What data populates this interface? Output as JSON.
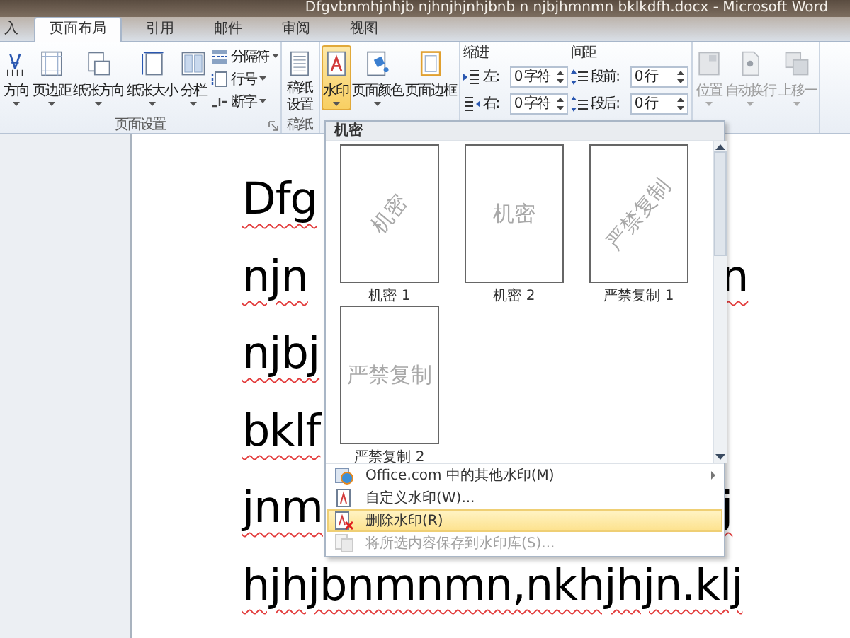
{
  "window": {
    "title": "Dfgvbnmhjnhjb njhnjhjnhjbnb  n njbjhmnmn bklkdfh.docx - Microsoft Word"
  },
  "tabs": [
    {
      "label": "入",
      "selected": false
    },
    {
      "label": "页面布局",
      "selected": true
    },
    {
      "label": "引用",
      "selected": false
    },
    {
      "label": "邮件",
      "selected": false
    },
    {
      "label": "审阅",
      "selected": false
    },
    {
      "label": "视图",
      "selected": false
    }
  ],
  "ribbon": {
    "groups": [
      {
        "kind": "buttons",
        "label": "页面设置",
        "launcher": true,
        "large_buttons": [
          {
            "label": "方向",
            "dropdown": true
          },
          {
            "label": "页边距",
            "dropdown": true
          },
          {
            "label": "纸张方向",
            "dropdown": true
          },
          {
            "label": "纸张大小",
            "dropdown": true
          },
          {
            "label": "分栏",
            "dropdown": true
          }
        ],
        "small_buttons": [
          {
            "label": "分隔符",
            "dropdown": true
          },
          {
            "label": "行号",
            "dropdown": true
          },
          {
            "label": "断字",
            "dropdown": true
          }
        ]
      },
      {
        "kind": "buttons",
        "label": "稿纸",
        "large_buttons": [
          {
            "label": "稿纸设置",
            "dropdown": false,
            "wrapped": true
          }
        ]
      },
      {
        "kind": "buttons",
        "large_buttons": [
          {
            "label": "水印",
            "dropdown": true,
            "pressed": true
          },
          {
            "label": "页面颜色",
            "dropdown": true,
            "pressed": false
          },
          {
            "label": "页面边框",
            "dropdown": false,
            "pressed": false
          }
        ]
      },
      {
        "kind": "paragraph",
        "sections": [
          {
            "title": "缩进",
            "fields": [
              {
                "label": "左:",
                "value": "0 字符"
              },
              {
                "label": "右:",
                "value": "0 字符"
              }
            ]
          },
          {
            "title": "间距",
            "fields": [
              {
                "label": "段前:",
                "value": "0 行"
              },
              {
                "label": "段后:",
                "value": "0 行"
              }
            ]
          }
        ]
      },
      {
        "kind": "buttons",
        "large_buttons": [
          {
            "label": "位置",
            "dropdown": true,
            "disabled": true
          },
          {
            "label": "自动换行",
            "dropdown": true,
            "disabled": true
          },
          {
            "label": "上移一",
            "dropdown": true,
            "disabled": true
          }
        ]
      }
    ]
  },
  "document": {
    "lines": [
      {
        "left": "Dfg"
      },
      {
        "left": "njn",
        "right": "n"
      },
      {
        "left": "njbj"
      },
      {
        "left": "bklf"
      },
      {
        "left": "jnm",
        "right": "j"
      },
      {
        "left": "hjhjbnmnmn,nkhjhjn.klj"
      }
    ]
  },
  "watermark_menu": {
    "header": "机密",
    "gallery": [
      {
        "caption": "机密 1",
        "preview": "机密",
        "diagonal": true
      },
      {
        "caption": "机密 2",
        "preview": "机密",
        "diagonal": false
      },
      {
        "caption": "严禁复制 1",
        "preview": "严禁复制",
        "diagonal": true
      },
      {
        "caption": "严禁复制 2",
        "preview": "严禁复制",
        "diagonal": false
      }
    ],
    "items": [
      {
        "label": "Office.com 中的其他水印(M)",
        "kind": "submenu",
        "highlighted": false,
        "disabled": false
      },
      {
        "label": "自定义水印(W)...",
        "kind": "custom",
        "highlighted": false,
        "disabled": false
      },
      {
        "label": "删除水印(R)",
        "kind": "remove",
        "highlighted": true,
        "disabled": false
      },
      {
        "label": "将所选内容保存到水印库(S)...",
        "kind": "save",
        "highlighted": false,
        "disabled": true
      }
    ]
  }
}
